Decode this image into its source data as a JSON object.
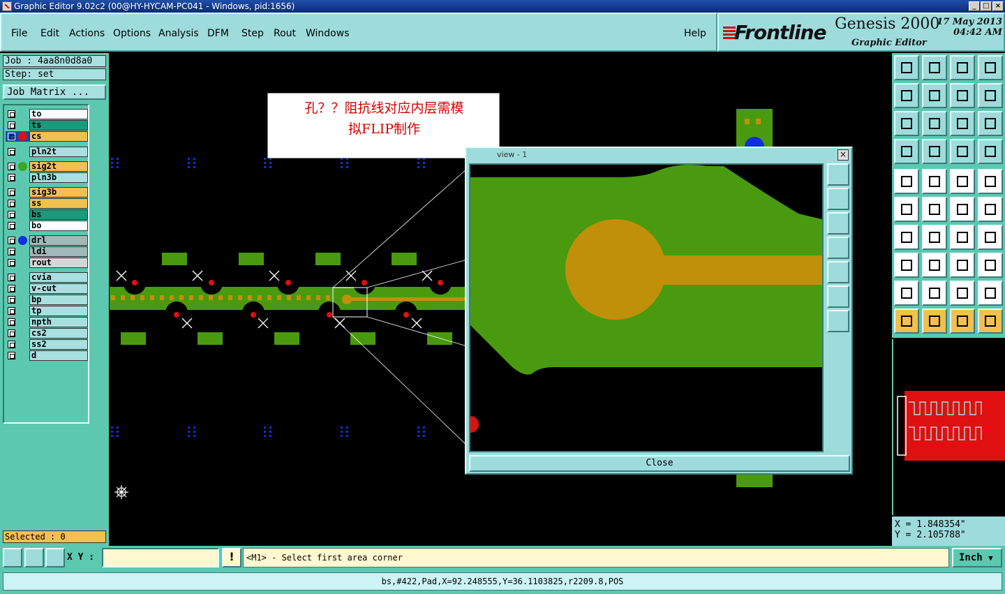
{
  "window": {
    "title": "Graphic Editor 9.02c2 (00@HY-HYCAM-PC041 - Windows, pid:1656)"
  },
  "menu": {
    "items": [
      "File",
      "Edit",
      "Actions",
      "Options",
      "Analysis",
      "DFM",
      "Step",
      "Rout",
      "Windows"
    ],
    "help": "Help"
  },
  "brand": {
    "logo": "Frontline",
    "product": "Genesis 2000",
    "subtitle": "Graphic Editor",
    "date": "17 May 2013",
    "time": "04:42 AM"
  },
  "job": {
    "job_label": "Job : 4aa8n0d8a0",
    "step_label": "Step: set",
    "matrix_button": "Job Matrix ..."
  },
  "layers": [
    {
      "name": "to",
      "color": "#ffffff",
      "dot": ""
    },
    {
      "name": "ts",
      "color": "#1a9a7a",
      "dot": ""
    },
    {
      "name": "cs",
      "color": "#f0c050",
      "dot": "#e01010",
      "selected": true
    },
    {
      "name": "pln2t",
      "color": "#a8e0e0",
      "dot": ""
    },
    {
      "name": "sig2t",
      "color": "#f0c050",
      "dot": "#3aa820"
    },
    {
      "name": "pln3b",
      "color": "#a8e0e0",
      "dot": ""
    },
    {
      "name": "sig3b",
      "color": "#f0c050",
      "dot": ""
    },
    {
      "name": "ss",
      "color": "#f0c050",
      "dot": ""
    },
    {
      "name": "bs",
      "color": "#1a9a7a",
      "dot": ""
    },
    {
      "name": "bo",
      "color": "#ffffff",
      "dot": ""
    },
    {
      "name": "drl",
      "color": "#a0b8b8",
      "dot": "#1030e0"
    },
    {
      "name": "ldi",
      "color": "#a0b8b8",
      "dot": ""
    },
    {
      "name": "rout",
      "color": "#d0d8d8",
      "dot": ""
    },
    {
      "name": "cvia",
      "color": "#a8e0e0",
      "dot": ""
    },
    {
      "name": "v-cut",
      "color": "#a8e0e0",
      "dot": ""
    },
    {
      "name": "bp",
      "color": "#a8e0e0",
      "dot": ""
    },
    {
      "name": "tp",
      "color": "#a8e0e0",
      "dot": ""
    },
    {
      "name": "npth",
      "color": "#a8e0e0",
      "dot": ""
    },
    {
      "name": "cs2",
      "color": "#a8e0e0",
      "dot": ""
    },
    {
      "name": "ss2",
      "color": "#a8e0e0",
      "dot": ""
    },
    {
      "name": "d",
      "color": "#a8e0e0",
      "dot": ""
    }
  ],
  "selected_label": "Selected : 0",
  "annotation": {
    "line1": "孔？？阻抗线对应内层需模",
    "line2": "拟FLIP制作"
  },
  "view_window": {
    "title": "view - 1",
    "close_label": "Close"
  },
  "coords": {
    "x": "X = 1.848354\"",
    "y": "Y = 2.105788\""
  },
  "command": {
    "xy_label": "X Y :",
    "xy_value": "",
    "prompt": "<M1> - Select first area corner",
    "unit": "Inch"
  },
  "status": "bs,#422,Pad,X=92.248555,Y=36.1103825,r2209.8,POS",
  "colors": {
    "panel": "#5cc8b0",
    "menu": "#9edcdc",
    "copper_green": "#4a9a10",
    "pad_gold": "#c0900a",
    "via_red": "#e01010",
    "drill_blue": "#1030e0"
  }
}
